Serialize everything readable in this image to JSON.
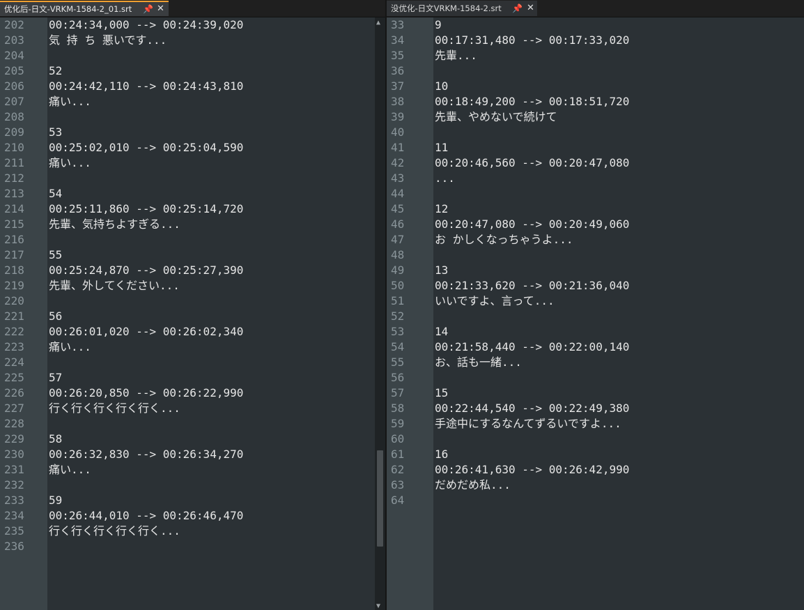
{
  "left": {
    "tab": {
      "title": "优化后-日文-VRKM-1584-2_01.srt",
      "pin": "📌",
      "close": "✕"
    },
    "line_numbers": [
      "202",
      "203",
      "204",
      "205",
      "206",
      "207",
      "208",
      "209",
      "210",
      "211",
      "212",
      "213",
      "214",
      "215",
      "216",
      "217",
      "218",
      "219",
      "220",
      "221",
      "222",
      "223",
      "224",
      "225",
      "226",
      "227",
      "228",
      "229",
      "230",
      "231",
      "232",
      "233",
      "234",
      "235",
      "236"
    ],
    "lines": [
      "00:24:34,000 --> 00:24:39,020",
      "気 持 ち 悪いです...",
      "",
      "52",
      "00:24:42,110 --> 00:24:43,810",
      "痛い...",
      "",
      "53",
      "00:25:02,010 --> 00:25:04,590",
      "痛い...",
      "",
      "54",
      "00:25:11,860 --> 00:25:14,720",
      "先輩、気持ちよすぎる...",
      "",
      "55",
      "00:25:24,870 --> 00:25:27,390",
      "先輩、外してください...",
      "",
      "56",
      "00:26:01,020 --> 00:26:02,340",
      "痛い...",
      "",
      "57",
      "00:26:20,850 --> 00:26:22,990",
      "行く行く行く行く行く...",
      "",
      "58",
      "00:26:32,830 --> 00:26:34,270",
      "痛い...",
      "",
      "59",
      "00:26:44,010 --> 00:26:46,470",
      "行く行く行く行く行く...",
      ""
    ],
    "scroll": {
      "up": "▲",
      "down": "▼"
    }
  },
  "right": {
    "tab": {
      "title": "没优化-日文VRKM-1584-2.srt",
      "pin": "📌",
      "close": "✕"
    },
    "line_numbers": [
      "33",
      "34",
      "35",
      "36",
      "37",
      "38",
      "39",
      "40",
      "41",
      "42",
      "43",
      "44",
      "45",
      "46",
      "47",
      "48",
      "49",
      "50",
      "51",
      "52",
      "53",
      "54",
      "55",
      "56",
      "57",
      "58",
      "59",
      "60",
      "61",
      "62",
      "63",
      "64"
    ],
    "lines": [
      "9",
      "00:17:31,480 --> 00:17:33,020",
      "先輩...",
      "",
      "10",
      "00:18:49,200 --> 00:18:51,720",
      "先輩、やめないで続けて",
      "",
      "11",
      "00:20:46,560 --> 00:20:47,080",
      "...",
      "",
      "12",
      "00:20:47,080 --> 00:20:49,060",
      "お かしくなっちゃうよ...",
      "",
      "13",
      "00:21:33,620 --> 00:21:36,040",
      "いいですよ、言って...",
      "",
      "14",
      "00:21:58,440 --> 00:22:00,140",
      "お、話も一緒...",
      "",
      "15",
      "00:22:44,540 --> 00:22:49,380",
      "手途中にするなんてずるいですよ...",
      "",
      "16",
      "00:26:41,630 --> 00:26:42,990",
      "だめだめ私...",
      ""
    ]
  }
}
